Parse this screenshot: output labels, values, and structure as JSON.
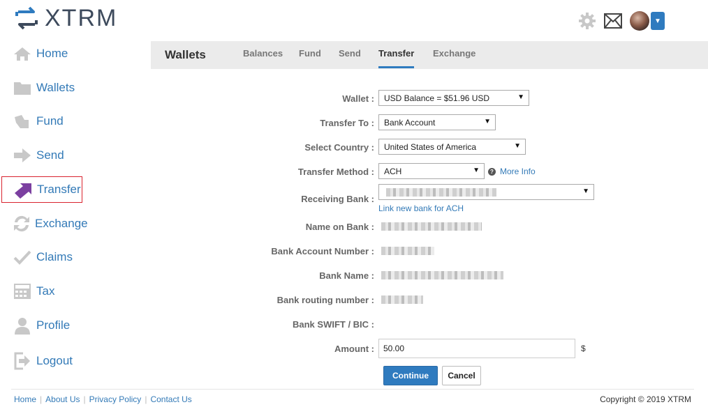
{
  "brand": {
    "name": "XTRM",
    "color": "#3d4a5c"
  },
  "header": {
    "icons": [
      "gear-icon",
      "mail-icon",
      "user-avatar",
      "caret-down-icon"
    ]
  },
  "sidebar": {
    "items": [
      {
        "label": "Home",
        "icon": "home-icon"
      },
      {
        "label": "Wallets",
        "icon": "folder-icon"
      },
      {
        "label": "Fund",
        "icon": "fund-icon"
      },
      {
        "label": "Send",
        "icon": "arrow-right-icon"
      },
      {
        "label": "Transfer",
        "icon": "transfer-arrow-icon",
        "active": true
      },
      {
        "label": "Exchange",
        "icon": "exchange-icon"
      },
      {
        "label": "Claims",
        "icon": "checkmark-icon"
      },
      {
        "label": "Tax",
        "icon": "calculator-icon"
      },
      {
        "label": "Profile",
        "icon": "person-icon"
      },
      {
        "label": "Logout",
        "icon": "logout-icon"
      }
    ]
  },
  "tabs": {
    "title": "Wallets",
    "items": [
      "Balances",
      "Fund",
      "Send",
      "Transfer",
      "Exchange"
    ],
    "active": "Transfer"
  },
  "form": {
    "wallet": {
      "label": "Wallet :",
      "value": "USD Balance = $51.96 USD"
    },
    "transfer_to": {
      "label": "Transfer To :",
      "value": "Bank Account"
    },
    "country": {
      "label": "Select Country :",
      "value": "United States of America"
    },
    "method": {
      "label": "Transfer Method :",
      "value": "ACH",
      "more_info": "More Info"
    },
    "receiving_bank": {
      "label": "Receiving Bank :",
      "link": "Link new bank for ACH"
    },
    "name_on_bank": {
      "label": "Name on Bank :"
    },
    "account_number": {
      "label": "Bank Account Number :"
    },
    "bank_name": {
      "label": "Bank Name :"
    },
    "routing": {
      "label": "Bank routing number :"
    },
    "swift": {
      "label": "Bank SWIFT / BIC :"
    },
    "amount": {
      "label": "Amount :",
      "value": "50.00",
      "currency": "$"
    },
    "continue": "Continue",
    "cancel": "Cancel"
  },
  "footer": {
    "links": [
      "Home",
      "About Us",
      "Privacy Policy",
      "Contact Us"
    ],
    "copyright": "Copyright © 2019 XTRM"
  },
  "colors": {
    "accent": "#2f7bbf",
    "link": "#337ab7",
    "active_border": "#d9232e",
    "transfer_icon": "#7b3fa0"
  }
}
